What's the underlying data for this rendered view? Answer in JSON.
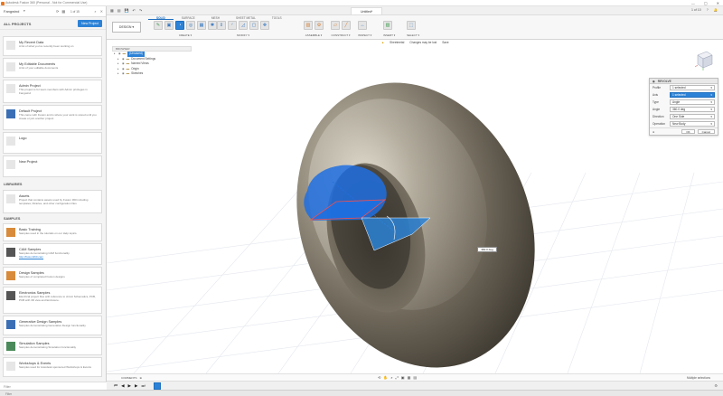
{
  "window": {
    "title": "Autodesk Fusion 360 (Personal - Not for Commercial Use)",
    "controls": [
      "—",
      "▢",
      "✕"
    ]
  },
  "data_panel": {
    "hub": "Fangwind",
    "page_indicator": "1 of 15",
    "section_all": "ALL PROJECTS",
    "new_project": "New Project",
    "projects": [
      {
        "name": "My Recent Data",
        "desc": "A list of what you've recently been working on"
      },
      {
        "name": "My Editable Documents",
        "desc": "A list of your editable documents"
      },
      {
        "name": "Admin Project",
        "desc": "This project is for team members with Admin privileges in Fangwind"
      },
      {
        "name": "Default Project",
        "desc": "This came with Fusion and is where your work is stored until you create or join another project."
      },
      {
        "name": "Logo",
        "desc": ""
      },
      {
        "name": "New Project",
        "desc": ""
      }
    ],
    "section_libraries": "LIBRARIES",
    "libraries": [
      {
        "name": "Assets",
        "desc": "Project that contains assets used by Fusion 360 including templates, libraries, and other configuration files"
      }
    ],
    "section_samples": "SAMPLES",
    "samples": [
      {
        "name": "Basic Training",
        "desc": "Samples used in the tutorials on our Help topics."
      },
      {
        "name": "CAM Samples",
        "desc": "Samples demonstrating CAM functionality.",
        "link": "http://fusion360.cam"
      },
      {
        "name": "Design Samples",
        "desc": "Samples of completed Fusion designs"
      },
      {
        "name": "Electronics Samples",
        "desc": "Electrical project files with reference to circuit Schematics, PCB, PCB with 3D view and Enclosure."
      },
      {
        "name": "Generative Design Samples",
        "desc": "Samples demonstrating Generative Design functionality"
      },
      {
        "name": "Simulation Samples",
        "desc": "Samples demonstrating Simulation functionality"
      },
      {
        "name": "Workshops & Events",
        "desc": "Samples used for Autodesk sponsored Workshops & Events"
      }
    ],
    "filter_placeholder": "Filter"
  },
  "document": {
    "tab_title": "Untitled*",
    "account_info": "1 of 10",
    "right_icons": [
      "?",
      "🔔"
    ]
  },
  "toolbar": {
    "workspace": "DESIGN ▾",
    "tabs": [
      "SOLID",
      "SURFACE",
      "MESH",
      "SHEET METAL",
      "TOOLS"
    ],
    "active_tab": "SOLID",
    "groups": [
      {
        "label": "CREATE ▾"
      },
      {
        "label": "MODIFY ▾"
      },
      {
        "label": "ASSEMBLE ▾"
      },
      {
        "label": "CONSTRUCT ▾"
      },
      {
        "label": "INSPECT ▾"
      },
      {
        "label": "INSERT ▾"
      },
      {
        "label": "SELECT ▾"
      }
    ]
  },
  "status": {
    "sheet_label": "Sheetmetal",
    "change_text": "Changes may be lost",
    "save": "Save"
  },
  "browser": {
    "header": "BROWSER",
    "items": [
      {
        "label": "(Unsaved)",
        "indent": 0,
        "selected": true
      },
      {
        "label": "Document Settings",
        "indent": 1
      },
      {
        "label": "Named Views",
        "indent": 1
      },
      {
        "label": "Origin",
        "indent": 1
      },
      {
        "label": "Sketches",
        "indent": 1
      }
    ]
  },
  "revolve_dialog": {
    "title": "REVOLVE",
    "rows": [
      {
        "label": "Profile",
        "value": "1 selected",
        "style": "plain"
      },
      {
        "label": "Axis",
        "value": "1 selected",
        "style": "blue"
      },
      {
        "label": "Type",
        "value": "Angle",
        "style": "plain"
      },
      {
        "label": "Angle",
        "value": "360.0 deg",
        "style": "plain"
      },
      {
        "label": "Direction",
        "value": "One Side",
        "style": "plain"
      },
      {
        "label": "Operation",
        "value": "New Body",
        "style": "plain"
      }
    ],
    "ok": "OK",
    "cancel": "Cancel"
  },
  "angle_label": "360.0 deg",
  "nav": {
    "comments": "COMMENTS",
    "selection_status": "Multiple selections"
  },
  "footer": {
    "filter_text": "Filter"
  },
  "colors": {
    "accent": "#2c82d6",
    "torus_light": "#b9b2a3",
    "torus_dark": "#3a352d",
    "profile_fill": "#1f6fe0"
  }
}
